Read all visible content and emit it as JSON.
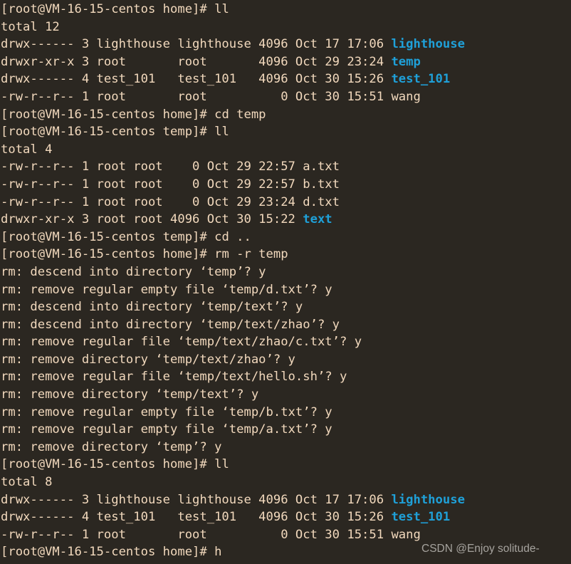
{
  "terminal": {
    "colors": {
      "background": "#2b2721",
      "foreground": "#f2d9bd",
      "directory": "#1fa0d8",
      "watermark": "#c8c5c0"
    },
    "prompt_home": "[root@VM-16-15-centos home]# ",
    "prompt_temp": "[root@VM-16-15-centos temp]# ",
    "lines": [
      {
        "type": "prompt",
        "prompt": "[root@VM-16-15-centos home]# ",
        "command": "ll"
      },
      {
        "type": "output",
        "text": "total 12"
      },
      {
        "type": "listing",
        "text": "drwx------ 3 lighthouse lighthouse 4096 Oct 17 17:06 ",
        "name": "lighthouse",
        "dir": true
      },
      {
        "type": "listing",
        "text": "drwxr-xr-x 3 root       root       4096 Oct 29 23:24 ",
        "name": "temp",
        "dir": true
      },
      {
        "type": "listing",
        "text": "drwx------ 4 test_101   test_101   4096 Oct 30 15:26 ",
        "name": "test_101",
        "dir": true
      },
      {
        "type": "listing",
        "text": "-rw-r--r-- 1 root       root          0 Oct 30 15:51 ",
        "name": "wang",
        "dir": false
      },
      {
        "type": "prompt",
        "prompt": "[root@VM-16-15-centos home]# ",
        "command": "cd temp"
      },
      {
        "type": "prompt",
        "prompt": "[root@VM-16-15-centos temp]# ",
        "command": "ll"
      },
      {
        "type": "output",
        "text": "total 4"
      },
      {
        "type": "listing",
        "text": "-rw-r--r-- 1 root root    0 Oct 29 22:57 ",
        "name": "a.txt",
        "dir": false
      },
      {
        "type": "listing",
        "text": "-rw-r--r-- 1 root root    0 Oct 29 22:57 ",
        "name": "b.txt",
        "dir": false
      },
      {
        "type": "listing",
        "text": "-rw-r--r-- 1 root root    0 Oct 29 23:24 ",
        "name": "d.txt",
        "dir": false
      },
      {
        "type": "listing",
        "text": "drwxr-xr-x 3 root root 4096 Oct 30 15:22 ",
        "name": "text",
        "dir": true
      },
      {
        "type": "prompt",
        "prompt": "[root@VM-16-15-centos temp]# ",
        "command": "cd .."
      },
      {
        "type": "prompt",
        "prompt": "[root@VM-16-15-centos home]# ",
        "command": "rm -r temp"
      },
      {
        "type": "output",
        "text": "rm: descend into directory ‘temp’? y"
      },
      {
        "type": "output",
        "text": "rm: remove regular empty file ‘temp/d.txt’? y"
      },
      {
        "type": "output",
        "text": "rm: descend into directory ‘temp/text’? y"
      },
      {
        "type": "output",
        "text": "rm: descend into directory ‘temp/text/zhao’? y"
      },
      {
        "type": "output",
        "text": "rm: remove regular file ‘temp/text/zhao/c.txt’? y"
      },
      {
        "type": "output",
        "text": "rm: remove directory ‘temp/text/zhao’? y"
      },
      {
        "type": "output",
        "text": "rm: remove regular file ‘temp/text/hello.sh’? y"
      },
      {
        "type": "output",
        "text": "rm: remove directory ‘temp/text’? y"
      },
      {
        "type": "output",
        "text": "rm: remove regular empty file ‘temp/b.txt’? y"
      },
      {
        "type": "output",
        "text": "rm: remove regular empty file ‘temp/a.txt’? y"
      },
      {
        "type": "output",
        "text": "rm: remove directory ‘temp’? y"
      },
      {
        "type": "prompt",
        "prompt": "[root@VM-16-15-centos home]# ",
        "command": "ll"
      },
      {
        "type": "output",
        "text": "total 8"
      },
      {
        "type": "listing",
        "text": "drwx------ 3 lighthouse lighthouse 4096 Oct 17 17:06 ",
        "name": "lighthouse",
        "dir": true
      },
      {
        "type": "listing",
        "text": "drwx------ 4 test_101   test_101   4096 Oct 30 15:26 ",
        "name": "test_101",
        "dir": true
      },
      {
        "type": "listing",
        "text": "-rw-r--r-- 1 root       root          0 Oct 30 15:51 ",
        "name": "wang",
        "dir": false
      },
      {
        "type": "prompt",
        "prompt": "[root@VM-16-15-centos home]# ",
        "command": "h"
      }
    ]
  },
  "watermark": {
    "text": "CSDN @Enjoy solitude-"
  }
}
